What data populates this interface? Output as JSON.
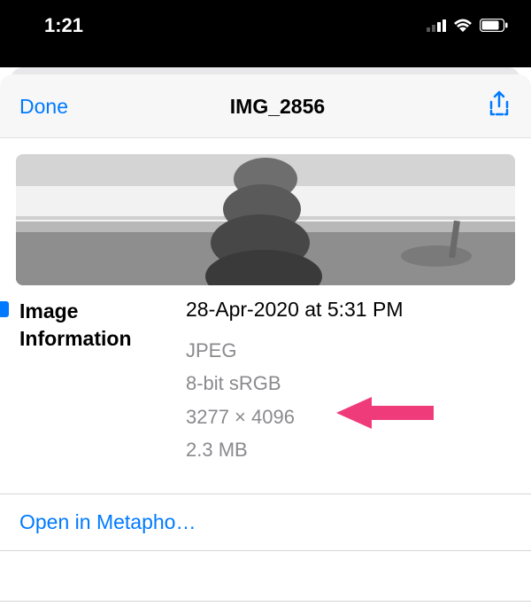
{
  "status_bar": {
    "time": "1:21"
  },
  "nav": {
    "done_label": "Done",
    "title": "IMG_2856"
  },
  "info": {
    "section_label": "Image Information",
    "date": "28-Apr-2020 at 5:31 PM",
    "format": "JPEG",
    "color": "8-bit sRGB",
    "dimensions": "3277 × 4096",
    "size": "2.3 MB"
  },
  "actions": {
    "open_in": "Open in Metapho…"
  }
}
